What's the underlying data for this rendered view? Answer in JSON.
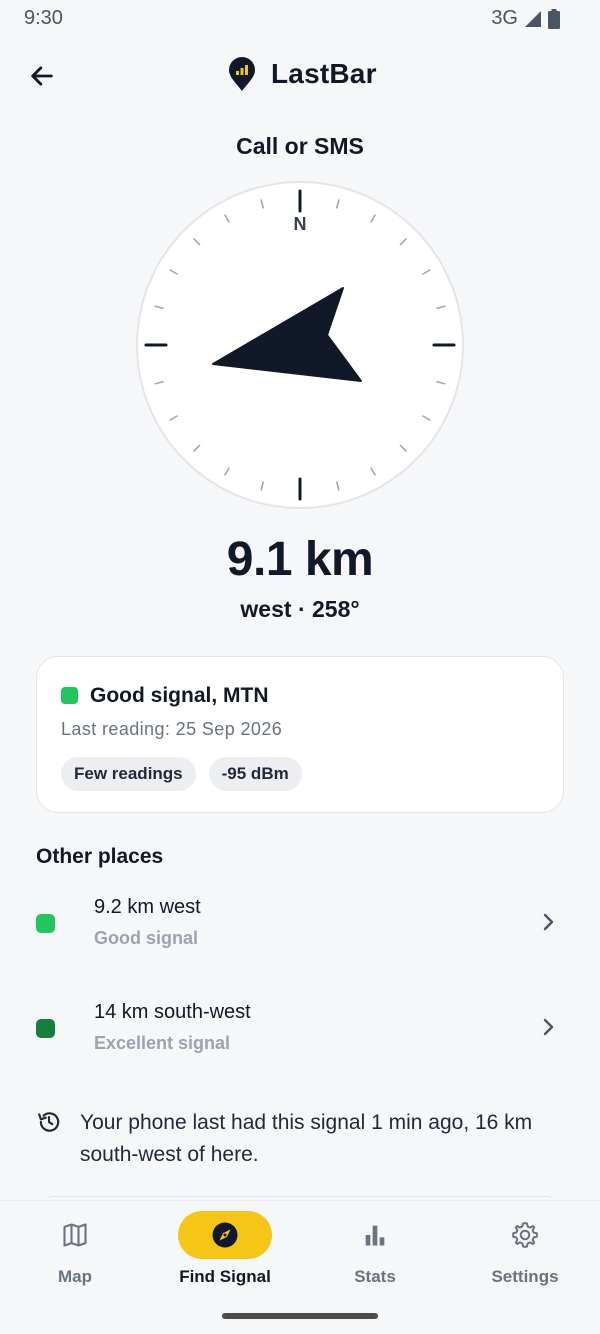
{
  "status_bar": {
    "time": "9:30",
    "network": "3G"
  },
  "app_bar": {
    "title": "LastBar"
  },
  "finder": {
    "mode_title": "Call or SMS",
    "compass_north_label": "N",
    "distance": "9.1 km",
    "direction": "west · 258°"
  },
  "signal_card": {
    "title": "Good signal, MTN",
    "last_reading": "Last reading: 25 Sep 2026",
    "chips": [
      "Few readings",
      "-95 dBm"
    ],
    "status_color": "#22c55e"
  },
  "other_places": {
    "heading": "Other places",
    "items": [
      {
        "title": "9.2 km west",
        "subtitle": "Good signal",
        "color": "#22c55e"
      },
      {
        "title": "14 km south-west",
        "subtitle": "Excellent signal",
        "color": "#15803d"
      }
    ]
  },
  "history": {
    "text": "Your phone last had this signal 1 min ago, 16 km south-west of here."
  },
  "bottom_nav": {
    "items": [
      {
        "label": "Map",
        "icon": "map-icon"
      },
      {
        "label": "Find Signal",
        "icon": "compass-icon",
        "active": true
      },
      {
        "label": "Stats",
        "icon": "bar-chart-icon"
      },
      {
        "label": "Settings",
        "icon": "gear-icon"
      }
    ]
  },
  "colors": {
    "accent": "#f5c518",
    "text": "#111827",
    "muted": "#6b7280"
  }
}
